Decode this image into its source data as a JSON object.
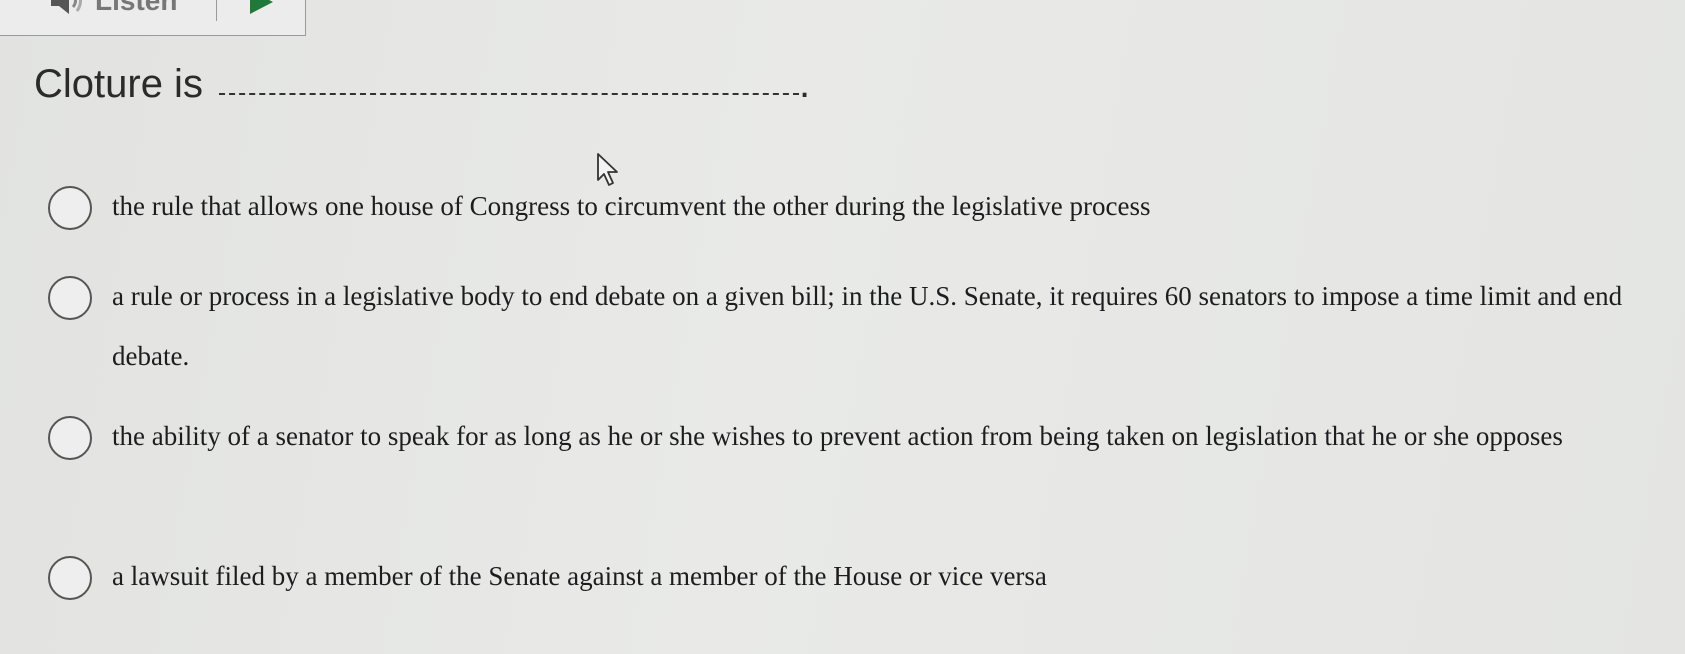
{
  "toolbar": {
    "listen_label": "Listen",
    "speaker_icon": "speaker-icon",
    "play_icon": "play-icon"
  },
  "question": {
    "text": "Cloture is",
    "end": "."
  },
  "options": [
    {
      "label": "the rule that allows one house of Congress to circumvent the other during the legislative process"
    },
    {
      "label": "a rule or process in a legislative body to end debate on a given bill; in the U.S. Senate, it requires 60 senators to impose a time limit and end debate."
    },
    {
      "label": "the ability of a senator to speak for as long as he or she wishes to prevent action from being taken on legislation that he or she opposes"
    },
    {
      "label": "a lawsuit filed by a member of the Senate against a member of the House or vice versa"
    }
  ]
}
